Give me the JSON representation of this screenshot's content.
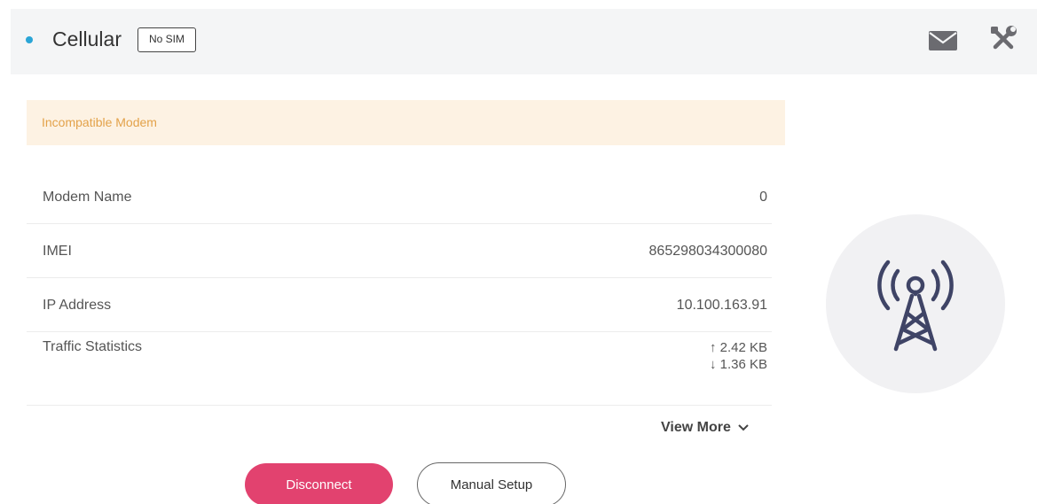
{
  "header": {
    "title": "Cellular",
    "sim_badge": "No SIM",
    "status_color": "#2aa5d6",
    "icons": [
      "mail-icon",
      "tools-icon"
    ]
  },
  "alert": {
    "text": "Incompatible Modem",
    "color": "#e3a24a",
    "background": "#fdf2e3"
  },
  "info": [
    {
      "label": "Modem Name",
      "value": "0"
    },
    {
      "label": "IMEI",
      "value": "865298034300080"
    },
    {
      "label": "IP Address",
      "value": "10.100.163.91"
    }
  ],
  "traffic": {
    "label": "Traffic Statistics",
    "upload": "2.42 KB",
    "download": "1.36 KB"
  },
  "view_more": "View More",
  "buttons": {
    "disconnect": "Disconnect",
    "manual_setup": "Manual Setup",
    "accent": "#e2426f"
  },
  "side_icon": "cell-tower-icon"
}
